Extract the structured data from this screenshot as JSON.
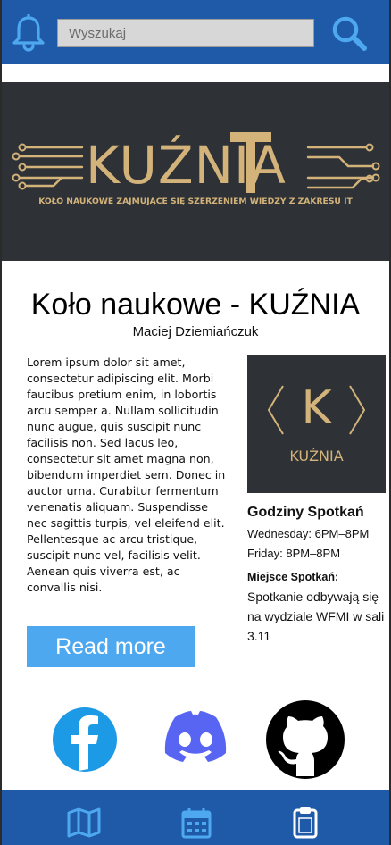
{
  "header": {
    "search_placeholder": "Wyszukaj"
  },
  "banner": {
    "title": "KUŹNIA",
    "subtitle": "KOŁO NAUKOWE ZAJMUJĄCE SIĘ SZERZENIEM WIEDZY Z ZAKRESU IT"
  },
  "article": {
    "title": "Koło naukowe - KUŹNIA",
    "author": "Maciej Dziemiańczuk",
    "body": "Lorem ipsum dolor sit amet, consectetur adipiscing elit. Morbi faucibus pretium enim, in lobortis arcu semper a. Nullam sollicitudin nunc augue, quis suscipit nunc facilisis non. Sed lacus leo, consectetur sit amet magna non, bibendum imperdiet sem. Donec in auctor urna. Curabitur fermentum venenatis aliquam. Suspendisse nec sagittis turpis, vel eleifend elit. Pellentesque ac arcu tristique, suscipit nunc vel, facilisis velit. Aenean quis viverra est, ac convallis nisi.",
    "read_more_label": "Read more"
  },
  "logo_card": {
    "letter": "K",
    "name": "KUŹNIA"
  },
  "meetings": {
    "title": "Godziny Spotkań",
    "lines": [
      "Wednesday: 6PM–8PM",
      "Friday: 8PM–8PM"
    ],
    "place_title": "Miejsce Spotkań:",
    "place_text": "Spotkanie odbywają się na wydziale WFMI w sali 3.11"
  },
  "social": [
    "facebook-icon",
    "discord-icon",
    "github-icon"
  ],
  "bottom_nav": [
    "map-icon",
    "calendar-icon",
    "clipboard-icon"
  ],
  "colors": {
    "bar_blue": "#1e5aa8",
    "icon_blue": "#4ea8f0",
    "banner_dark": "#2e3236",
    "gold": "#d3b37a",
    "facebook": "#1c9ae6",
    "discord": "#5865f2"
  }
}
